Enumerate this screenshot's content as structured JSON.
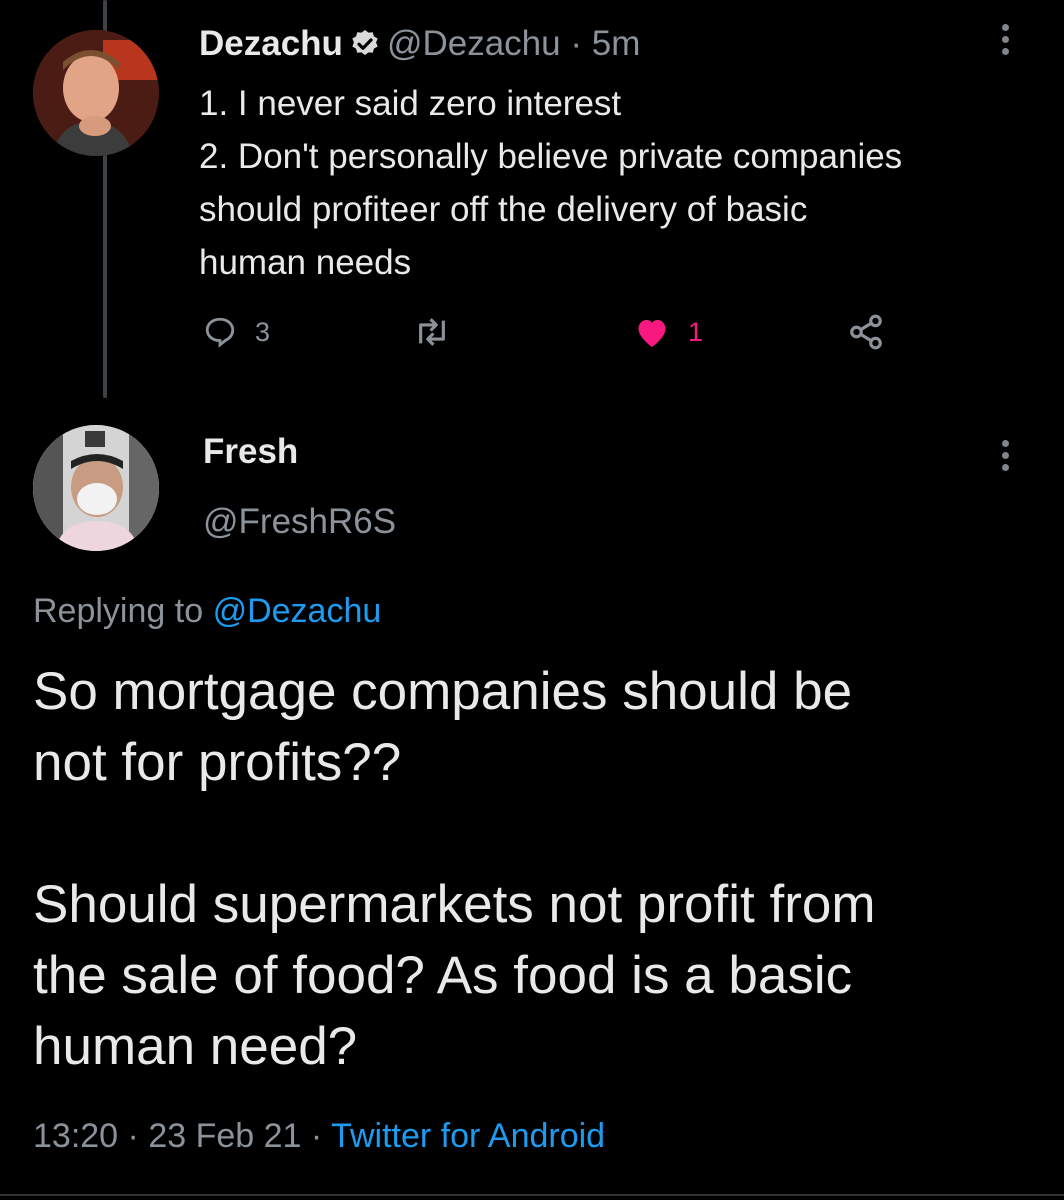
{
  "tweet1": {
    "name": "Dezachu",
    "handle": "@Dezachu",
    "time": "5m",
    "separator": "·",
    "lines": [
      "1. I never said zero interest",
      "2. Don't personally believe private companies",
      "should profiteer off the delivery of basic",
      "human needs"
    ],
    "reply_count": "3",
    "like_count": "1",
    "icons": [
      "avatar",
      "verified-badge-icon",
      "more-vert-icon",
      "reply-icon",
      "retweet-icon",
      "heart-icon",
      "share-icon"
    ],
    "colors": {
      "like": "#f91880",
      "verified": "#d9d9d9"
    }
  },
  "tweet2": {
    "name": "Fresh",
    "handle": "@FreshR6S",
    "replying_prefix": "Replying to",
    "replying_to": "@Dezachu",
    "paragraph1": [
      "So mortgage companies should be",
      "not for profits??"
    ],
    "paragraph2": [
      "Should supermarkets not profit from",
      "the sale of food? As food is a basic",
      "human need?"
    ],
    "time": "13:20",
    "date": "23 Feb 21",
    "separator": "·",
    "source": "Twitter for Android",
    "colors": {
      "link": "#1d9bf0"
    }
  }
}
